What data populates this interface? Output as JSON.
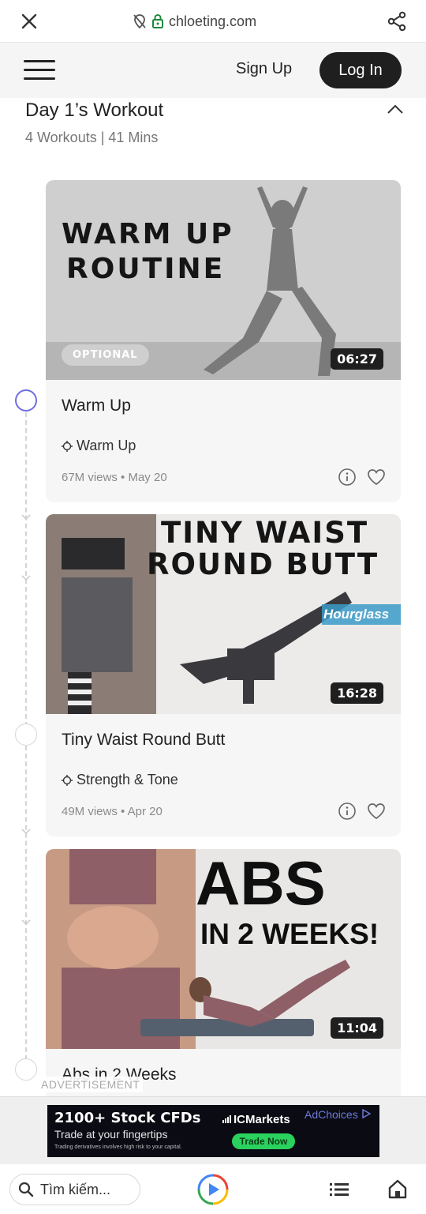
{
  "browser": {
    "url": "chloeting.com"
  },
  "header": {
    "signup_label": "Sign Up",
    "login_label": "Log In"
  },
  "day": {
    "title": "Day 1’s Workout",
    "subtitle": "4 Workouts | 41 Mins"
  },
  "workouts": [
    {
      "thumb_line1": "WARM UP",
      "thumb_line2": "ROUTINE",
      "badge": "OPTIONAL",
      "duration": "06:27",
      "title": "Warm Up",
      "category": "Warm Up",
      "views": "67M views",
      "date": "May 20"
    },
    {
      "thumb_line1": "TINY WAIST",
      "thumb_line2": "ROUND BUTT",
      "thumb_tag": "Hourglass",
      "duration": "16:28",
      "title": "Tiny Waist Round Butt",
      "category": "Strength & Tone",
      "views": "49M views",
      "date": "Apr 20"
    },
    {
      "thumb_line1": "ABS",
      "thumb_line2": "IN 2 WEEKS!",
      "duration": "11:04",
      "title": "Abs in 2 Weeks"
    }
  ],
  "meta_separator": "•",
  "ad": {
    "label": "ADVERTISEMENT",
    "headline": "2100+ Stock  CFDs",
    "subline": "Trade at your fingertips",
    "fineprint": "Trading derivatives involves high risk to your capital.",
    "brand": "ICMarkets",
    "choices": "AdChoices",
    "cta": "Trade Now"
  },
  "bottom_nav": {
    "search_placeholder": "Tìm kiếm..."
  },
  "colors": {
    "accent_active_circle": "#6f6fe0",
    "login_bg": "#1f1f1f",
    "ad_cta": "#2bd15e"
  }
}
